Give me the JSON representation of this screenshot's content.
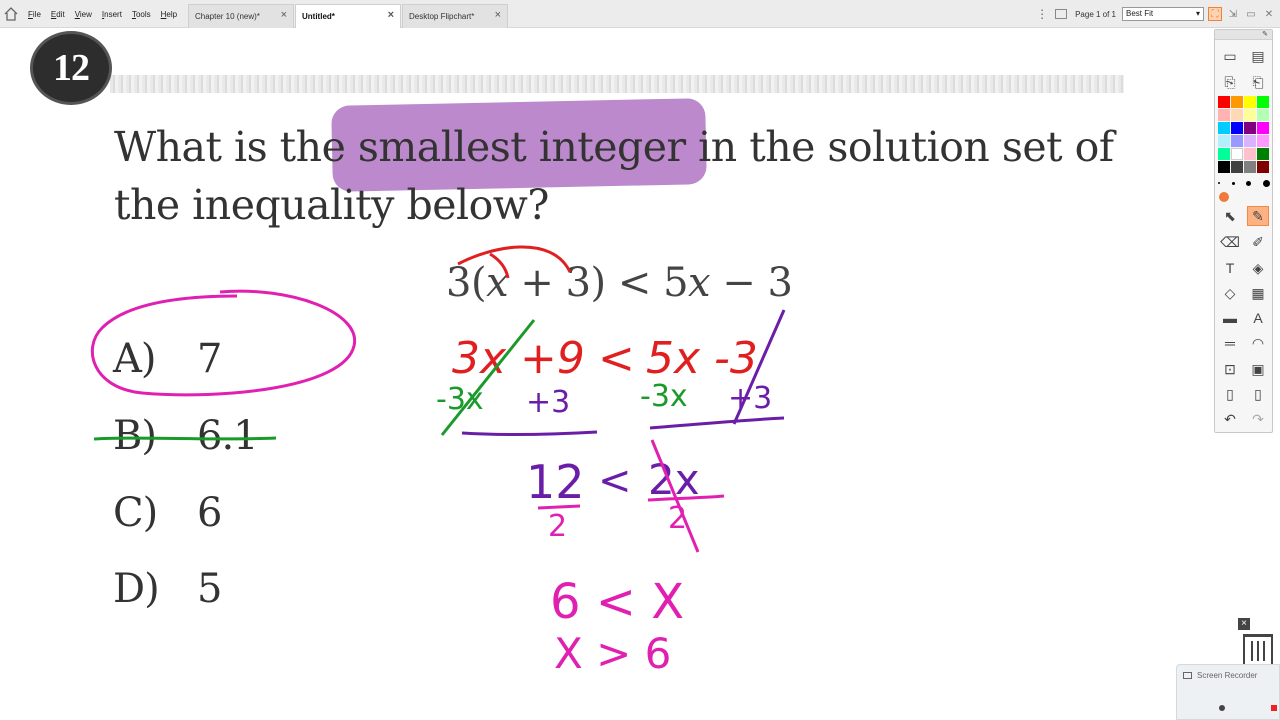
{
  "menu": [
    "File",
    "Edit",
    "View",
    "Insert",
    "Tools",
    "Help"
  ],
  "tabs": [
    {
      "label": "Chapter 10 (new)*",
      "active": false
    },
    {
      "label": "Untitled*",
      "active": true
    },
    {
      "label": "Desktop Flipchart*",
      "active": false
    }
  ],
  "tab_close": "×",
  "page_label": "Page 1 of 1",
  "zoom": "Best Fit",
  "question": {
    "number": "12",
    "text": "What is the smallest integer in the solution set of the inequality below?"
  },
  "choices": [
    {
      "letter": "A)",
      "value": "7"
    },
    {
      "letter": "B)",
      "value": "6.1"
    },
    {
      "letter": "C)",
      "value": "6"
    },
    {
      "letter": "D)",
      "value": "5"
    }
  ],
  "equation": {
    "part1": "3(",
    "var1": "x",
    "part2": " + 3) < 5",
    "var2": "x",
    "part3": " − 3"
  },
  "handwriting": {
    "step1_left": "3x +9",
    "step1_op": "<",
    "step1_right": "5x -3",
    "sub_left_a": "-3x",
    "sub_left_b": "+3",
    "sub_right_a": "-3x",
    "sub_right_b": "+3",
    "step2_left": "12",
    "step2_op": "<",
    "step2_right": "2x",
    "div_left": "2",
    "div_right": "2",
    "step3": "6 < X",
    "step4": "X > 6"
  },
  "colors": {
    "red": "#e02020",
    "green": "#1a9a2a",
    "purple": "#6a1ea8",
    "magenta": "#e020b0",
    "highlight": "#b883c9",
    "toolbar_orange": "#f28a46"
  },
  "palette": [
    "#ff0000",
    "#ff9900",
    "#ffff00",
    "#00ff00",
    "#ffb3b3",
    "#ffd9b3",
    "#ffff99",
    "#b3ffb3",
    "#00ccff",
    "#0000ff",
    "#800080",
    "#ff00ff",
    "#b3f0ff",
    "#9999ff",
    "#d9b3ff",
    "#ff99ff",
    "#00ff99",
    "#ffffff",
    "#ffc0cb",
    "#008000",
    "#000000",
    "#404040",
    "#808080",
    "#800000"
  ],
  "toolbox_icons": [
    [
      "window-icon",
      "screen-icon"
    ],
    [
      "page-back-icon",
      "page-forward-icon"
    ],
    [
      "select-icon",
      "pen-icon"
    ],
    [
      "eraser-icon",
      "highlighter-icon"
    ],
    [
      "text-icon",
      "fill-icon"
    ],
    [
      "shapes-icon",
      "calculator-icon"
    ],
    [
      "reveal-icon",
      "handwriting-recognition-icon"
    ],
    [
      "ruler-icon",
      "protractor-icon"
    ],
    [
      "camera-icon",
      "recorder-icon"
    ],
    [
      "flipchart-icon",
      "clipboard-icon"
    ],
    [
      "undo-icon",
      "redo-icon"
    ]
  ],
  "toolbox_glyphs": [
    [
      "▭",
      "▤"
    ],
    [
      "⎘",
      "⎗"
    ],
    [
      "⬉",
      "✎"
    ],
    [
      "⌫",
      "✐"
    ],
    [
      "T",
      "◈"
    ],
    [
      "◇",
      "▦"
    ],
    [
      "▬",
      "A"
    ],
    [
      "═",
      "◠"
    ],
    [
      "⊡",
      "▣"
    ],
    [
      "▯",
      "▯"
    ],
    [
      "↶",
      "↷"
    ]
  ],
  "trash_close": "×",
  "recorder_title": "Screen Recorder"
}
